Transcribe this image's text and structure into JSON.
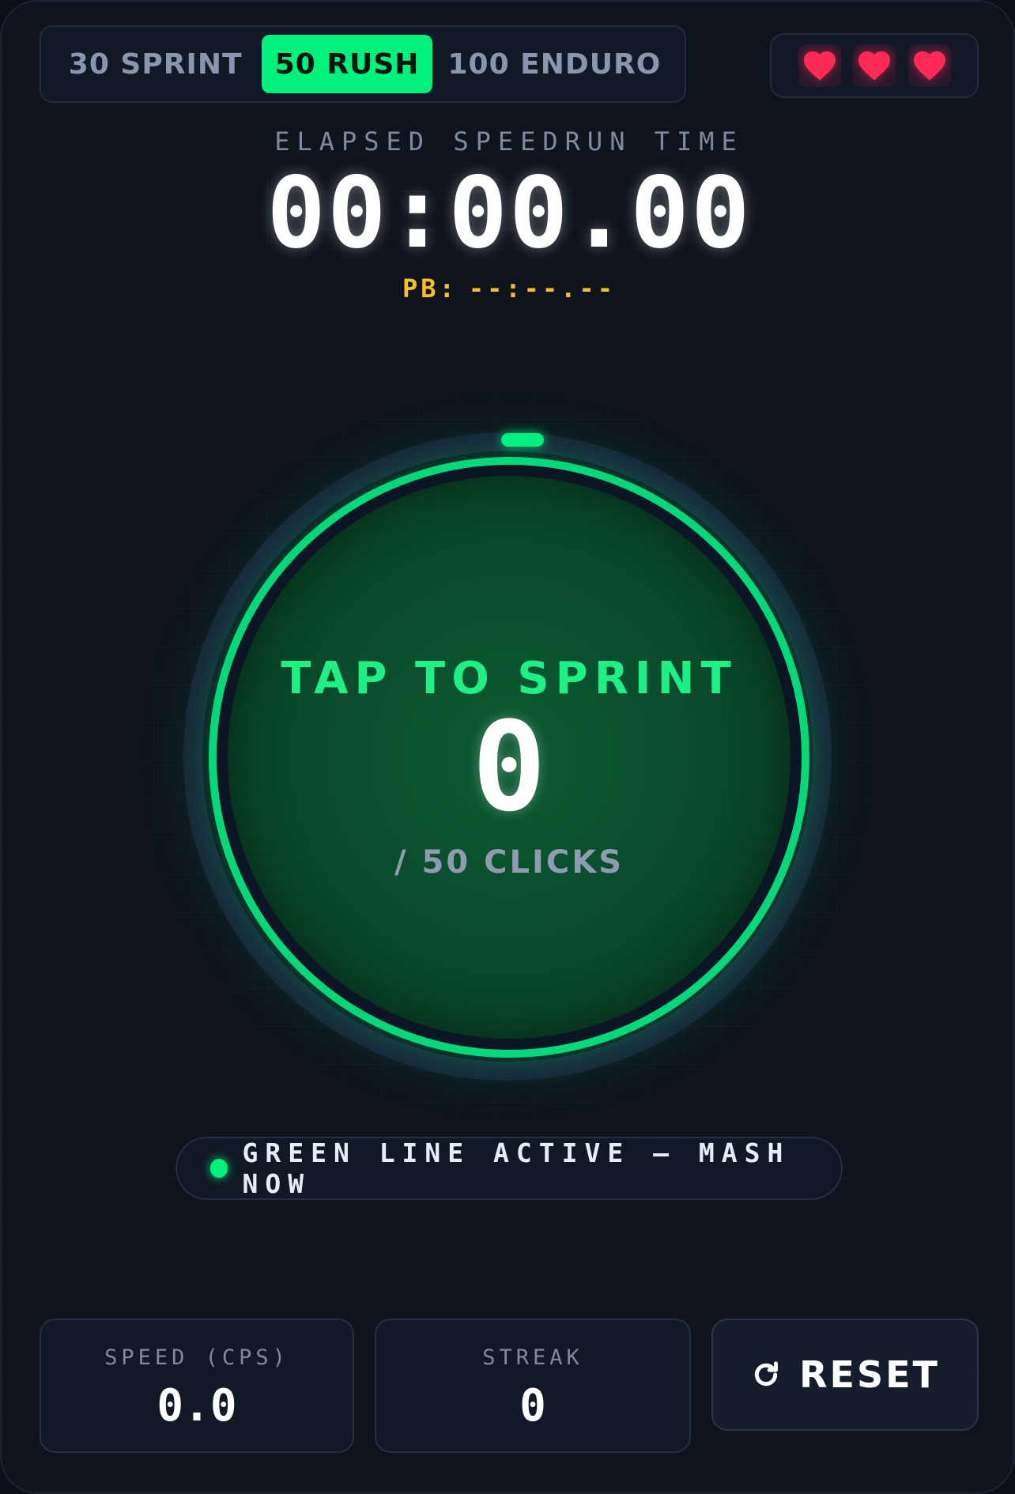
{
  "modes": {
    "items": [
      {
        "label": "30 SPRINT"
      },
      {
        "label": "50 RUSH"
      },
      {
        "label": "100 ENDURO"
      }
    ],
    "selected": "50 RUSH"
  },
  "lives": {
    "count": 3,
    "icon": "heart-icon",
    "color": "#ff2a55"
  },
  "timer": {
    "label": "ELAPSED SPEEDRUN TIME",
    "value": "00:00.00",
    "pb_label": "PB:",
    "pb_value": "--:--.--"
  },
  "tap": {
    "title": "TAP TO SPRINT",
    "count": "0",
    "total": "/ 50 CLICKS"
  },
  "status": {
    "text": "GREEN LINE ACTIVE — MASH NOW",
    "color": "#00f07e"
  },
  "stats": {
    "speed_label": "SPEED (CPS)",
    "speed_value": "0.0",
    "streak_label": "STREAK",
    "streak_value": "0"
  },
  "reset": {
    "label": "RESET",
    "icon": "refresh-icon"
  },
  "colors": {
    "accent": "#00f07e",
    "pb": "#f5c02a",
    "heart": "#ff2a55"
  }
}
